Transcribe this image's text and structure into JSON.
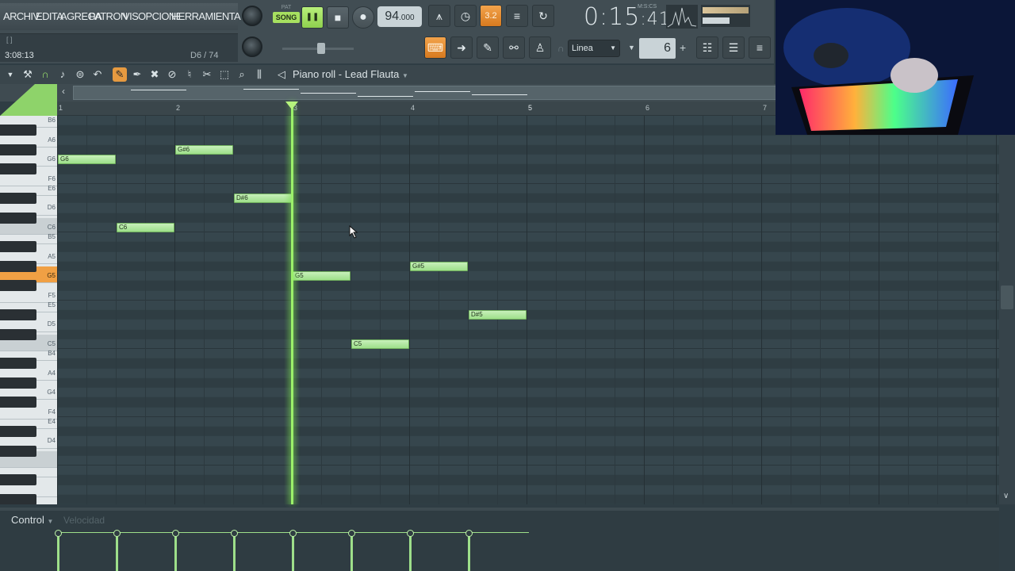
{
  "menu": [
    "ARCHIV",
    "EDITA",
    "AGREGA",
    "PATRON",
    "VIS",
    "OPCIONE",
    "HERRAMIENTA"
  ],
  "hint": {
    "bracket": "[ ]",
    "position": "3:08:13",
    "note_info": "D6 / 74"
  },
  "transport": {
    "pat_label": "PAT",
    "song_label": "SONG",
    "pause": "❚❚",
    "stop": "■",
    "record": "●"
  },
  "tempo": {
    "int": "94",
    "frac": ".000"
  },
  "time": {
    "main": "0:15",
    "small": ":41",
    "unit": "M:S:CS"
  },
  "pattern_num": "3.2",
  "snap": {
    "value": "Linea",
    "step": "6"
  },
  "piano_roll": {
    "title": "Piano roll - Lead Flauta"
  },
  "bars": [
    "1",
    "2",
    "3",
    "4",
    "5",
    "6",
    "7"
  ],
  "keys": [
    "B6",
    "A6",
    "G6",
    "F6",
    "E6",
    "D6",
    "C6",
    "B5",
    "A5",
    "G5",
    "F5",
    "E5",
    "D5",
    "C5",
    "B4",
    "A4",
    "G4",
    "F4",
    "E4",
    "D4"
  ],
  "notes": [
    {
      "label": "G6"
    },
    {
      "label": "C6"
    },
    {
      "label": "G#6"
    },
    {
      "label": "D#6"
    },
    {
      "label": "G5"
    },
    {
      "label": "C5"
    },
    {
      "label": "G#5"
    },
    {
      "label": "D#5"
    }
  ],
  "control": {
    "label": "Control",
    "sub": "Velocidad"
  },
  "colors": {
    "note": "#9edf8a",
    "playhead": "#9bf06a",
    "accent": "#f0a044",
    "grid": "#34434a"
  }
}
